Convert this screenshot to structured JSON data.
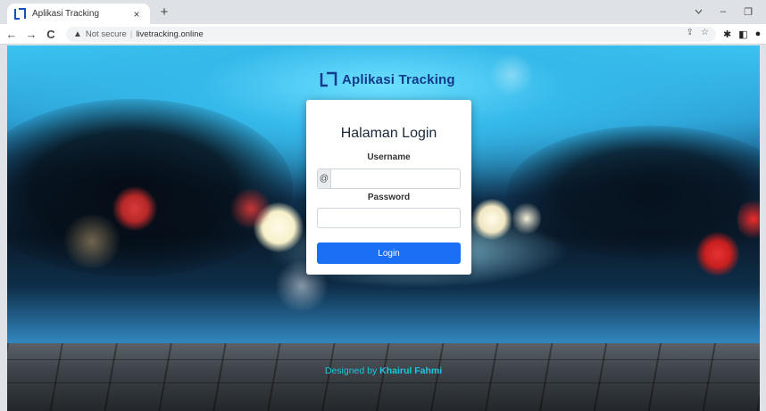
{
  "browser": {
    "tab_title": "Aplikasi Tracking",
    "tab_close": "×",
    "new_tab": "+",
    "security_label": "Not secure",
    "url_separator": "|",
    "url": "livetracking.online",
    "window_controls": {
      "minimize": "–",
      "restore": "❐",
      "close": "✕"
    },
    "nav": {
      "back": "←",
      "forward": "→",
      "reload": "C"
    }
  },
  "page": {
    "brand": "Aplikasi Tracking",
    "login_title": "Halaman Login",
    "username_label": "Username",
    "username_addon": "@",
    "username_value": "",
    "password_label": "Password",
    "password_value": "",
    "login_button": "Login",
    "footer_prefix": "Designed by",
    "footer_author": "Khairul Fahmi"
  },
  "colors": {
    "brand": "#123a8c",
    "button": "#1b6ff5",
    "footer": "#1ec6e6"
  }
}
